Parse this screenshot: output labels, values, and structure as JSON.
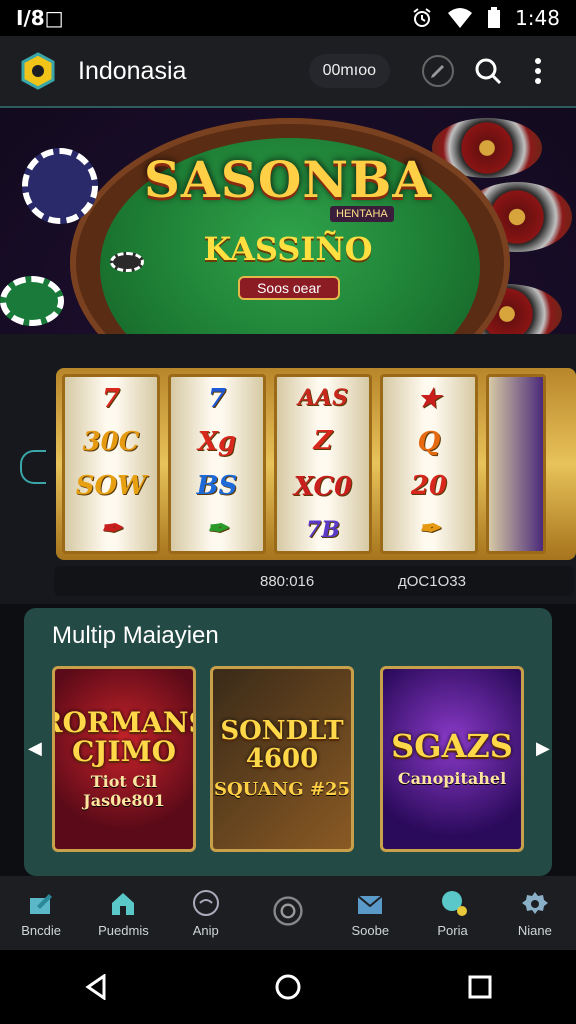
{
  "status_bar": {
    "left_text": "I/8□",
    "time": "1:48"
  },
  "app_bar": {
    "title": "Indonasia",
    "coins": "00mıoo"
  },
  "banner": {
    "title": "SASONBA",
    "tag": "HENTAHA",
    "subtitle": "KASSIÑO",
    "button_label": "Soos oear"
  },
  "slot": {
    "reels": [
      [
        "7",
        "30C",
        "SOW",
        "✒"
      ],
      [
        "7",
        "Xg",
        "BS",
        "✒"
      ],
      [
        "AAS",
        "Z",
        "XC0",
        "7B"
      ],
      [
        "★",
        "Q",
        "20",
        "✒"
      ]
    ],
    "info_left": "880:016",
    "info_right": "дOC1O33"
  },
  "multiplayer": {
    "title": "Multip Maiayien",
    "cards": [
      {
        "big": "RORMANS CJIMO",
        "small": "Tiot Cil Jas0e801"
      },
      {
        "big": "SONDLT 4600",
        "small": "SQUANG #25"
      },
      {
        "big": "SGAZS",
        "small": "Canopitahel"
      }
    ]
  },
  "bottom_nav": [
    {
      "label": "Bncdie",
      "icon": "pen-icon"
    },
    {
      "label": "Puedmis",
      "icon": "home-icon"
    },
    {
      "label": "Anip",
      "icon": "chat-icon"
    },
    {
      "label": "",
      "icon": "coin-icon"
    },
    {
      "label": "Soobe",
      "icon": "envelope-icon"
    },
    {
      "label": "Poria",
      "icon": "profile-icon"
    },
    {
      "label": "Niane",
      "icon": "gear-icon"
    }
  ],
  "colors": {
    "accent": "#3aa6a8",
    "panel": "#244a46",
    "gold": "#ffcf45",
    "background": "#0d0e12"
  }
}
